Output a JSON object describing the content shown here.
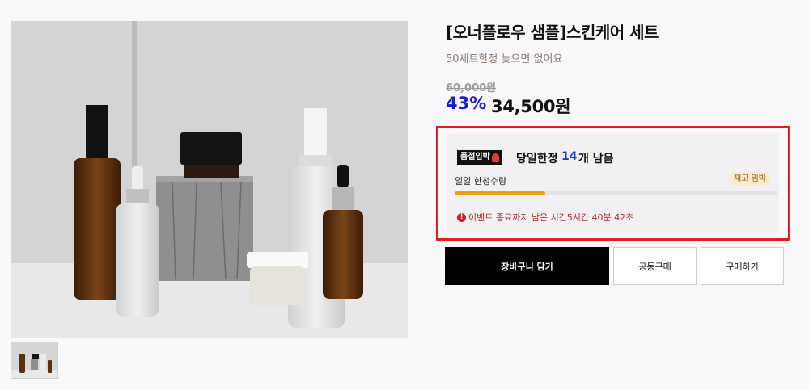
{
  "product": {
    "title": "[오너플로우 샘플]스킨케어 세트",
    "subtitle": "50세트한정 늦으면 없어요",
    "original_price": "60,000원",
    "discount_rate": "43%",
    "sale_price": "34,500원"
  },
  "gallery": {
    "main_image": "skincare-bottles-photo",
    "thumbnails": [
      "skincare-bottles-thumbnail"
    ]
  },
  "limited": {
    "badge_label": "품절임박",
    "badge_icon": "fire-icon",
    "today_label": "당일한정",
    "remaining_count": "14",
    "remaining_suffix": "개 남음",
    "quantity_label": "일일 한정수량",
    "stock_badge": "재고 임박",
    "progress_fraction": 0.28,
    "event_icon": "alert-icon",
    "event_text": "이벤트 종료까지 남은 시간5시간 40분 42초"
  },
  "actions": {
    "cart": "장바구니 담기",
    "group_buy": "공동구매",
    "buy": "구매하기"
  },
  "colors": {
    "discount": "#1a1ad0",
    "count": "#1a3ad0",
    "highlight_border": "#e02020",
    "progress": "#f29d0d",
    "event_text": "#c0262a"
  }
}
